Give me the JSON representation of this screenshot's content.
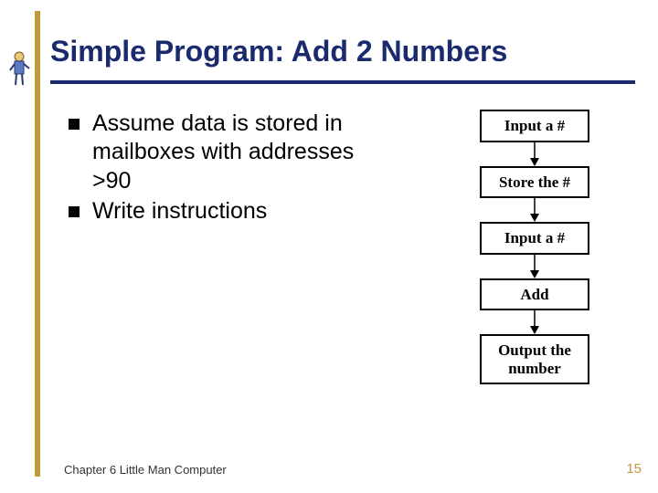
{
  "title": "Simple Program:  Add 2 Numbers",
  "bullets": [
    "Assume data is stored in mailboxes with addresses >90",
    "Write instructions"
  ],
  "flow": [
    "Input a #",
    "Store the #",
    "Input a #",
    "Add",
    "Output the number"
  ],
  "footer": {
    "left": "Chapter 6 Little Man Computer",
    "right": "15"
  },
  "colors": {
    "accent_bar": "#c19b3a",
    "title_color": "#1a2a6c"
  }
}
